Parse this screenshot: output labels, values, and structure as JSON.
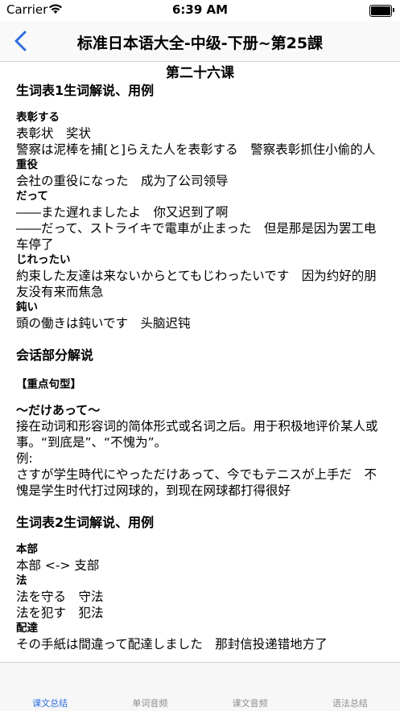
{
  "status": {
    "carrier": "Carrier",
    "time": "6:39 AM"
  },
  "nav": {
    "title": "标准日本语大全-中级-下册~第25課"
  },
  "lesson": {
    "title": "第二十六课",
    "section1": {
      "heading": "生词表1生词解说、用例",
      "entries": [
        {
          "word": "表彰する",
          "lines": [
            "表彰状　奖状",
            "警察は泥棒を捕[と]らえた人を表彰する　警察表彰抓住小偷的人"
          ]
        },
        {
          "word": "重役",
          "lines": [
            "会社の重役になった　成为了公司领导"
          ]
        },
        {
          "word": "だって",
          "lines": [
            "――また遅れましたよ　你又迟到了啊",
            "――だって、ストライキで電車が止まった　但是那是因为罢工电车停了"
          ]
        },
        {
          "word": "じれったい",
          "lines": [
            "約束した友達は来ないからとてもじわったいです　因为约好的朋友没有来而焦急"
          ]
        },
        {
          "word": "鈍い",
          "lines": [
            "頭の働きは鈍いです　头脑迟钝"
          ]
        }
      ]
    },
    "section2": {
      "heading": "会话部分解说",
      "pattern_head": "【重点句型】",
      "pattern_name": "～だけあって～",
      "lines": [
        "接在动词和形容词的简体形式或名词之后。用于积极地评价某人或事。“到底是”、“不愧为”。",
        "例:",
        "さすが学生時代にやっただけあって、今でもテニスが上手だ　不愧是学生时代打过网球的，到现在网球都打得很好"
      ]
    },
    "section3": {
      "heading": "生词表2生词解说、用例",
      "entries": [
        {
          "word": "本部",
          "lines": [
            "本部 <-> 支部"
          ]
        },
        {
          "word": "法",
          "lines": [
            "法を守る　守法",
            "法を犯す　犯法"
          ]
        },
        {
          "word": "配達",
          "lines": [
            "その手紙は間違って配達しました　那封信投递错地方了"
          ]
        }
      ]
    }
  },
  "tabs": [
    "课文总结",
    "单词音频",
    "课文音频",
    "语法总结"
  ],
  "colors": {
    "accent": "#2f6fe0",
    "inactive": "#8e8e93"
  }
}
